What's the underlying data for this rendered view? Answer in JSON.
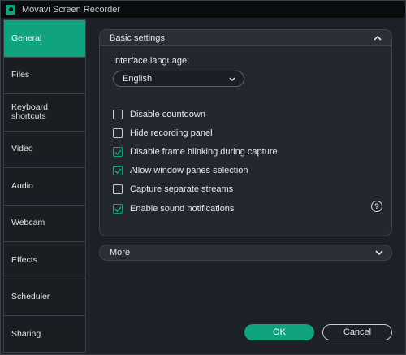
{
  "window": {
    "title": "Movavi Screen Recorder",
    "accent": "#0fa37f"
  },
  "sidebar": {
    "items": [
      {
        "label": "General",
        "active": true
      },
      {
        "label": "Files"
      },
      {
        "label": "Keyboard shortcuts"
      },
      {
        "label": "Video"
      },
      {
        "label": "Audio"
      },
      {
        "label": "Webcam"
      },
      {
        "label": "Effects"
      },
      {
        "label": "Scheduler"
      },
      {
        "label": "Sharing"
      }
    ]
  },
  "basic_settings": {
    "title": "Basic settings",
    "language_label": "Interface language:",
    "language_value": "English",
    "options": [
      {
        "label": "Disable countdown",
        "checked": false
      },
      {
        "label": "Hide recording panel",
        "checked": false
      },
      {
        "label": "Disable frame blinking during capture",
        "checked": true
      },
      {
        "label": "Allow window panes selection",
        "checked": true
      },
      {
        "label": "Capture separate streams",
        "checked": false
      },
      {
        "label": "Enable sound notifications",
        "checked": true
      }
    ],
    "help_symbol": "?"
  },
  "more": {
    "title": "More"
  },
  "buttons": {
    "ok": "OK",
    "cancel": "Cancel"
  }
}
